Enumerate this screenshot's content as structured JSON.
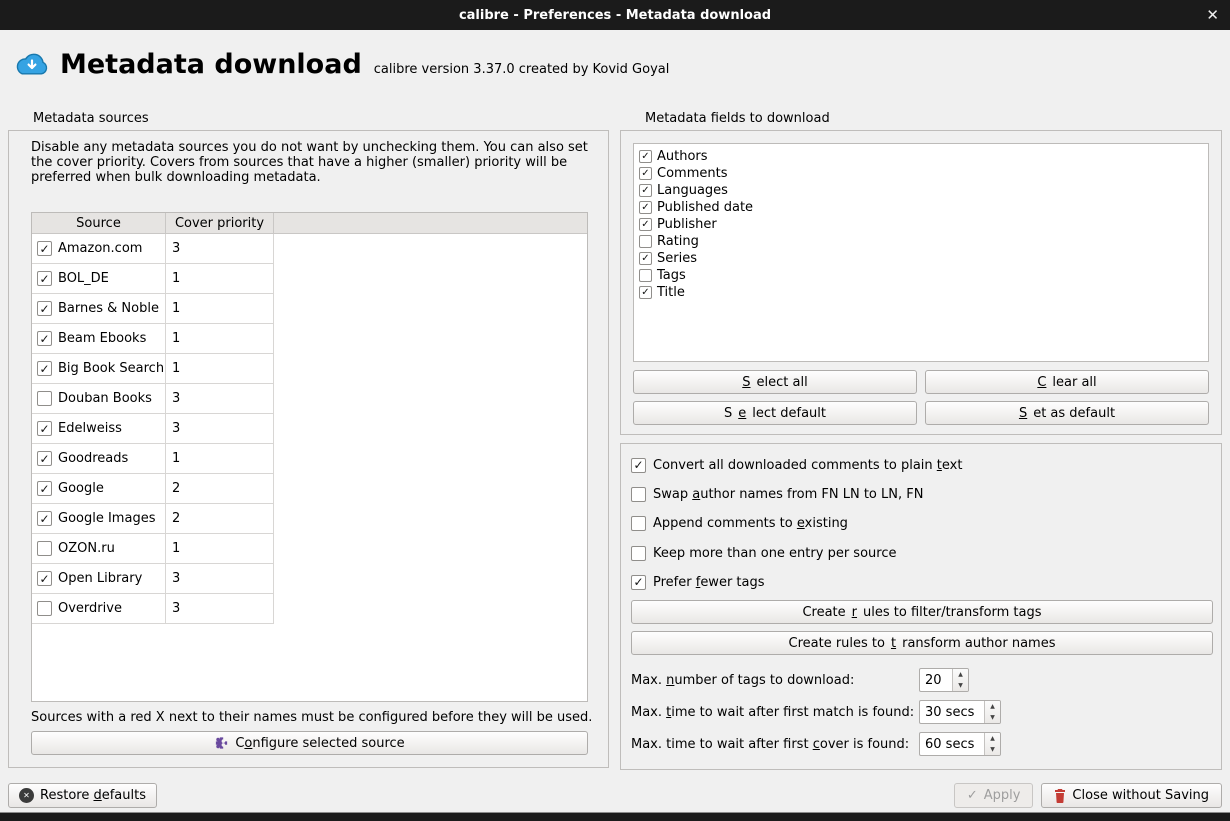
{
  "colors": {
    "titlebar_bg": "#1b1b1b",
    "window_bg": "#f0f0f0",
    "accent_blue": "#35a3e3",
    "puzzle_purple": "#6a4a9e",
    "trash_red": "#c43c35",
    "disabled_text": "#9e9e9e"
  },
  "icons": {
    "check": "✓",
    "close": "✕",
    "spin_up": "▲",
    "spin_down": "▼",
    "apply_check": "✓",
    "restore_x": "✕"
  },
  "window": {
    "title": "calibre - Preferences - Metadata download"
  },
  "header": {
    "title": "Metadata download",
    "subtitle": "calibre version 3.37.0 created by Kovid Goyal"
  },
  "sources": {
    "group_title": "Metadata sources",
    "description": "Disable any metadata sources you do not want by unchecking them. You can also set the cover priority. Covers from sources that have a higher (smaller) priority will be preferred when bulk downloading metadata.",
    "columns": {
      "source": "Source",
      "priority": "Cover priority"
    },
    "rows": [
      {
        "name": "Amazon.com",
        "checked": true,
        "priority": "3"
      },
      {
        "name": "BOL_DE",
        "checked": true,
        "priority": "1"
      },
      {
        "name": "Barnes & Noble",
        "checked": true,
        "priority": "1"
      },
      {
        "name": "Beam Ebooks",
        "checked": true,
        "priority": "1"
      },
      {
        "name": "Big Book Search",
        "checked": true,
        "priority": "1"
      },
      {
        "name": "Douban Books",
        "checked": false,
        "priority": "3"
      },
      {
        "name": "Edelweiss",
        "checked": true,
        "priority": "3"
      },
      {
        "name": "Goodreads",
        "checked": true,
        "priority": "1"
      },
      {
        "name": "Google",
        "checked": true,
        "priority": "2"
      },
      {
        "name": "Google Images",
        "checked": true,
        "priority": "2"
      },
      {
        "name": "OZON.ru",
        "checked": false,
        "priority": "1"
      },
      {
        "name": "Open Library",
        "checked": true,
        "priority": "3"
      },
      {
        "name": "Overdrive",
        "checked": false,
        "priority": "3"
      }
    ],
    "note": "Sources with a red X next to their names must be configured before they will be used.",
    "configure_button": {
      "pre": "C",
      "u": "o",
      "post": "nfigure selected source"
    }
  },
  "fields": {
    "group_title": "Metadata fields to download",
    "items": [
      {
        "label": "Authors",
        "checked": true
      },
      {
        "label": "Comments",
        "checked": true
      },
      {
        "label": "Languages",
        "checked": true
      },
      {
        "label": "Published date",
        "checked": true
      },
      {
        "label": "Publisher",
        "checked": true
      },
      {
        "label": "Rating",
        "checked": false
      },
      {
        "label": "Series",
        "checked": true
      },
      {
        "label": "Tags",
        "checked": false
      },
      {
        "label": "Title",
        "checked": true
      }
    ],
    "buttons": {
      "select_all": {
        "pre": "",
        "u": "S",
        "post": "elect all"
      },
      "clear_all": {
        "pre": "",
        "u": "C",
        "post": "lear all"
      },
      "select_default": {
        "pre": "S",
        "u": "e",
        "post": "lect default"
      },
      "set_as_default": {
        "pre": "",
        "u": "S",
        "post": "et as default"
      }
    }
  },
  "options": {
    "checkboxes": [
      {
        "checked": true,
        "gap_before": false,
        "label": {
          "pre": "Convert all downloaded comments to plain ",
          "u": "t",
          "post": "ext"
        }
      },
      {
        "checked": false,
        "gap_before": false,
        "label": {
          "pre": "Swap ",
          "u": "a",
          "post": "uthor names from FN LN to LN, FN"
        }
      },
      {
        "checked": false,
        "gap_before": false,
        "label": {
          "pre": "Append comments to ",
          "u": "e",
          "post": "xisting"
        }
      },
      {
        "checked": false,
        "gap_before": true,
        "label": {
          "pre": "Keep more than one entry per source",
          "u": "",
          "post": ""
        }
      },
      {
        "checked": true,
        "gap_before": false,
        "label": {
          "pre": "Prefer ",
          "u": "f",
          "post": "ewer tags"
        }
      }
    ],
    "buttons": {
      "filter_tags": {
        "pre": "Create ",
        "u": "r",
        "post": "ules to filter/transform tags"
      },
      "transform_authors": {
        "pre": "Create rules to ",
        "u": "t",
        "post": "ransform author names"
      }
    },
    "spinners": [
      {
        "label": {
          "pre": "Max. ",
          "u": "n",
          "post": "umber of tags to download:"
        },
        "value": "20"
      },
      {
        "label": {
          "pre": "Max. ",
          "u": "t",
          "post": "ime to wait after first match is found:"
        },
        "value": "30 secs"
      },
      {
        "label": {
          "pre": "Max. time to wait after first ",
          "u": "c",
          "post": "over is found:"
        },
        "value": "60 secs"
      }
    ]
  },
  "footer": {
    "restore": {
      "pre": "Restore ",
      "u": "d",
      "post": "efaults"
    },
    "apply": "Apply",
    "close": "Close without Saving"
  }
}
